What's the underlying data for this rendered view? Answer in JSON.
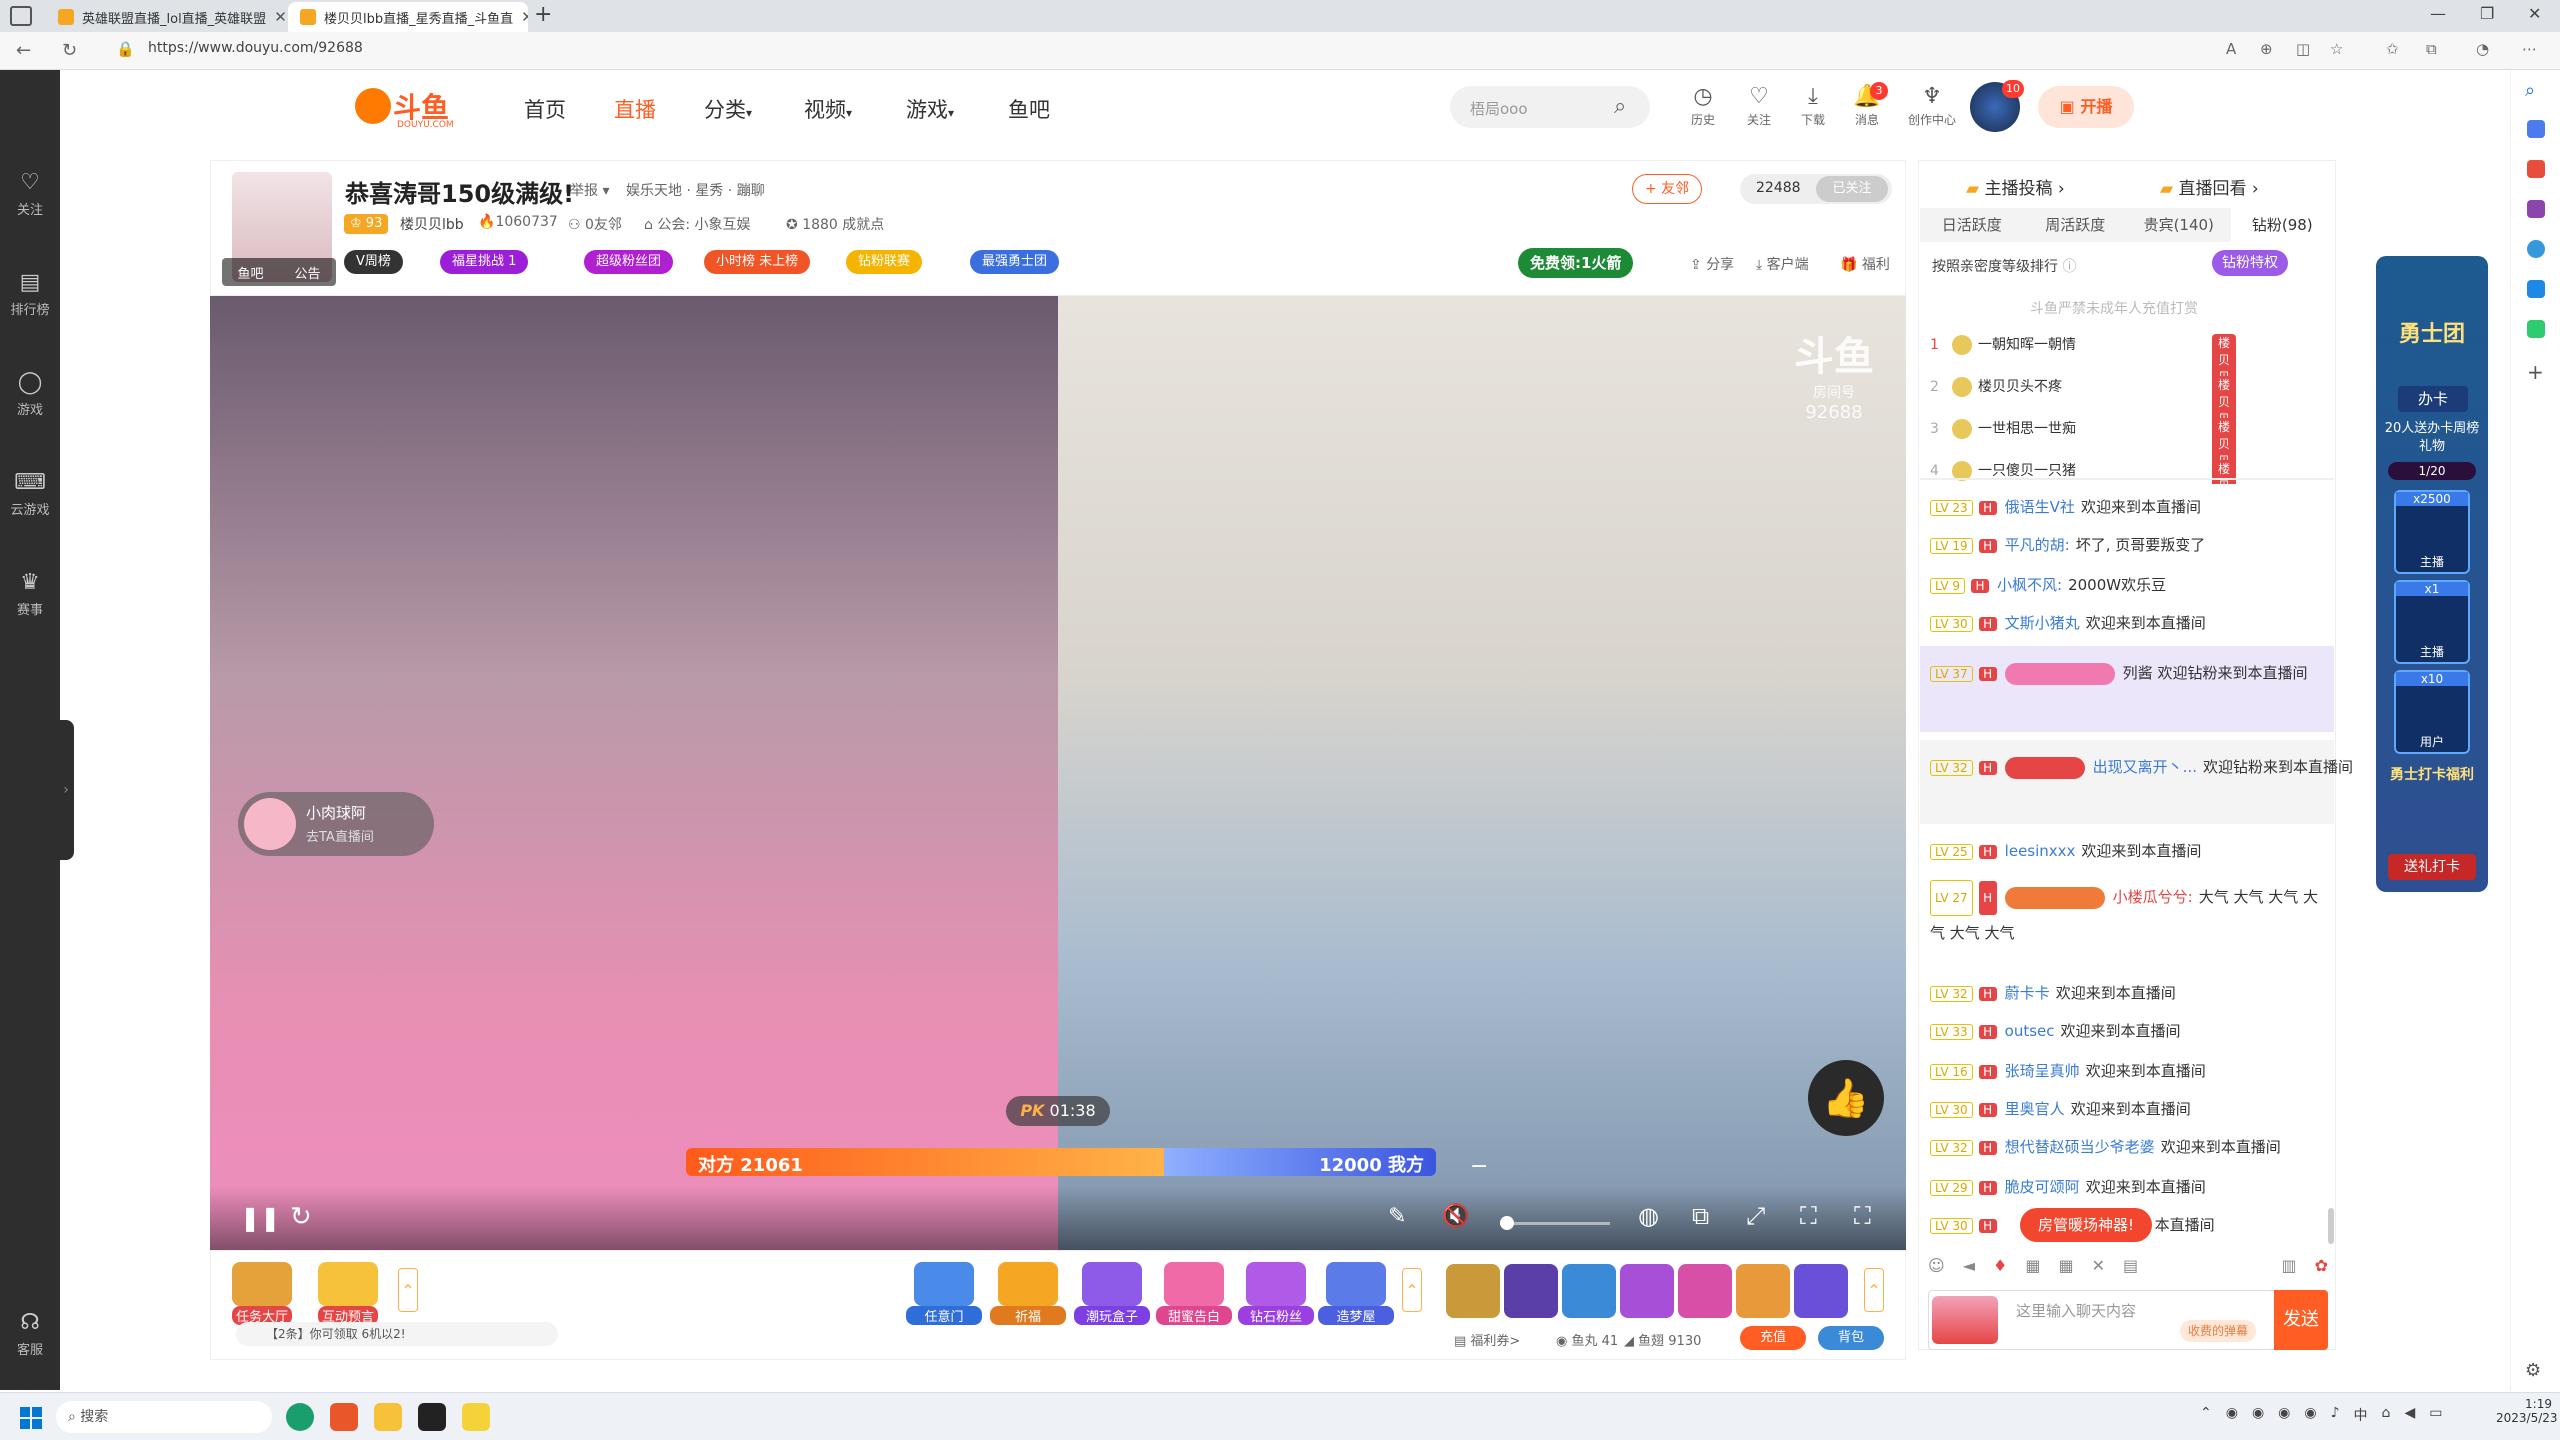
{
  "browser": {
    "tabs": [
      {
        "title": "英雄联盟直播_lol直播_英雄联盟"
      },
      {
        "title": "楼贝贝lbb直播_星秀直播_斗鱼直"
      }
    ],
    "url": "https://www.douyu.com/92688"
  },
  "left_sidebar": [
    {
      "label": "关注",
      "icon": "heart-icon"
    },
    {
      "label": "排行榜",
      "icon": "rank-icon"
    },
    {
      "label": "游戏",
      "icon": "game-icon"
    },
    {
      "label": "云游戏",
      "icon": "gamepad-icon"
    },
    {
      "label": "赛事",
      "icon": "trophy-icon"
    },
    {
      "label": "客服",
      "icon": "headset-icon"
    }
  ],
  "header": {
    "logo_text": "斗鱼",
    "logo_sub": "DOUYU.COM",
    "nav": [
      "首页",
      "直播",
      "分类",
      "视频",
      "游戏",
      "鱼吧"
    ],
    "nav_dropdowns": [
      "分类",
      "视频",
      "游戏"
    ],
    "search_placeholder": "梧局ooo",
    "icons": [
      {
        "label": "历史",
        "icon": "history-icon"
      },
      {
        "label": "关注",
        "icon": "heart-icon"
      },
      {
        "label": "下载",
        "icon": "download-icon"
      },
      {
        "label": "消息",
        "icon": "bell-icon",
        "badge": "3"
      },
      {
        "label": "创作中心",
        "icon": "bulb-icon"
      }
    ],
    "avatar_badge": "10",
    "open_button": "开播"
  },
  "room": {
    "title": "恭喜涛哥150级满级!",
    "report": "举报",
    "category": "娱乐天地 · 星秀 · 蹦聊",
    "level": "93",
    "anchor": "楼贝贝lbb",
    "heat": "1060737",
    "friends": "0友邻",
    "guild": "公会: 小象互娱",
    "achievement": "1880 成就点",
    "fish_bar": "鱼吧",
    "announcement": "公告",
    "friend_btn": "+ 友邻",
    "follow_count": "22488",
    "followed": "已关注",
    "badges": [
      "V周榜",
      "福星挑战 1",
      "超级粉丝团",
      "小时榜 未上榜",
      "钻粉联赛",
      "最强勇士团"
    ],
    "free_banner": "免费领:1火箭",
    "actions": [
      "分享",
      "客户端",
      "福利"
    ]
  },
  "video": {
    "watermark_line1": "斗鱼",
    "watermark_line2": "房间号",
    "room_number": "92688",
    "pk_label": "PK",
    "pk_time": "01:38",
    "opponent_label": "对方 21061",
    "self_label": "12000 我方",
    "pk_opponent_score": 21061,
    "pk_self_score": 12000,
    "guest_name": "小肉球阿",
    "guest_sub": "去TA直播间",
    "volume_level": 0.0
  },
  "right_panel": {
    "tabs_top": [
      "主播投稿",
      "直播回看"
    ],
    "rank_tabs": [
      "日活跃度",
      "周活跃度",
      "贵宾(140)",
      "钻粉(98)"
    ],
    "rank_note": "按照亲密度等级排行",
    "diamond_btn": "钻粉特权",
    "notice": "斗鱼严禁未成年人充值打赏",
    "ranks": [
      {
        "n": "1",
        "name": "一朝知晖一朝情",
        "tag": "楼贝贝"
      },
      {
        "n": "2",
        "name": "楼贝贝头不疼",
        "tag": "楼贝贝"
      },
      {
        "n": "3",
        "name": "一世相思一世痴",
        "tag": "楼贝贝"
      },
      {
        "n": "4",
        "name": "一只傻贝一只猪",
        "tag": "楼贝贝"
      }
    ],
    "chats": [
      {
        "lv": "LV 23",
        "name": "俄语生V社",
        "text": "欢迎来到本直播间"
      },
      {
        "lv": "LV 19",
        "name": "平凡的胡:",
        "text": "坏了, 页哥要叛变了"
      },
      {
        "lv": "LV 9",
        "name": "小枫不风:",
        "text": "2000W欢乐豆"
      },
      {
        "lv": "LV 30",
        "name": "文斯小猪丸",
        "text": "欢迎来到本直播间"
      },
      {
        "lv": "LV 37",
        "name": "列酱",
        "text": "欢迎钻粉来到本直播间"
      },
      {
        "lv": "LV 32",
        "name": "出现又离开丶...",
        "text": "欢迎钻粉来到本直播间"
      },
      {
        "lv": "LV 25",
        "name": "leesinxxx",
        "text": "欢迎来到本直播间"
      },
      {
        "lv": "LV 27",
        "name": "小楼瓜兮兮:",
        "text": "大气 大气 大气 大气 大气 大气"
      },
      {
        "lv": "LV 32",
        "name": "蔚卡卡",
        "text": "欢迎来到本直播间"
      },
      {
        "lv": "LV 33",
        "name": "outsec",
        "text": "欢迎来到本直播间"
      },
      {
        "lv": "LV 16",
        "name": "张琦呈真帅",
        "text": "欢迎来到本直播间"
      },
      {
        "lv": "LV 30",
        "name": "里奥官人",
        "text": "欢迎来到本直播间"
      },
      {
        "lv": "LV 32",
        "name": "想代替赵硕当少爷老婆",
        "text": "欢迎来到本直播间"
      },
      {
        "lv": "LV 29",
        "name": "脆皮可颂阿",
        "text": "欢迎来到本直播间"
      },
      {
        "lv": "LV 30",
        "name": "",
        "text": "本直播间"
      }
    ],
    "room_btn": "房管暖场神器!",
    "input_placeholder": "这里输入聊天内容",
    "send": "发送",
    "premium_tag": "收费的弹幕"
  },
  "activity": {
    "title": "勇士团",
    "card": "办卡",
    "text": "20人送办卡周榜礼物",
    "progress": "1/20",
    "items": [
      {
        "count": "x2500",
        "label": "主播"
      },
      {
        "count": "x1",
        "label": "主播"
      },
      {
        "count": "x10",
        "label": "用户"
      }
    ],
    "reward": "勇士打卡福利",
    "send_card": "送礼打卡"
  },
  "gift_bar": {
    "left": [
      "任务大厅",
      "互动预言"
    ],
    "middle": [
      "任意门",
      "祈福",
      "潮玩盒子",
      "甜蜜告白",
      "钻石粉丝",
      "造梦屋"
    ],
    "notice": "【2条】你可领取 6机以2!",
    "welfare": "福利券>",
    "fish_ball": "鱼丸 41",
    "fish_fin": "鱼翅 9130",
    "recharge": "充值",
    "bag": "背包"
  },
  "taskbar": {
    "search": "搜索",
    "time": "1:19",
    "date": "2023/5/23",
    "ime": "中"
  }
}
